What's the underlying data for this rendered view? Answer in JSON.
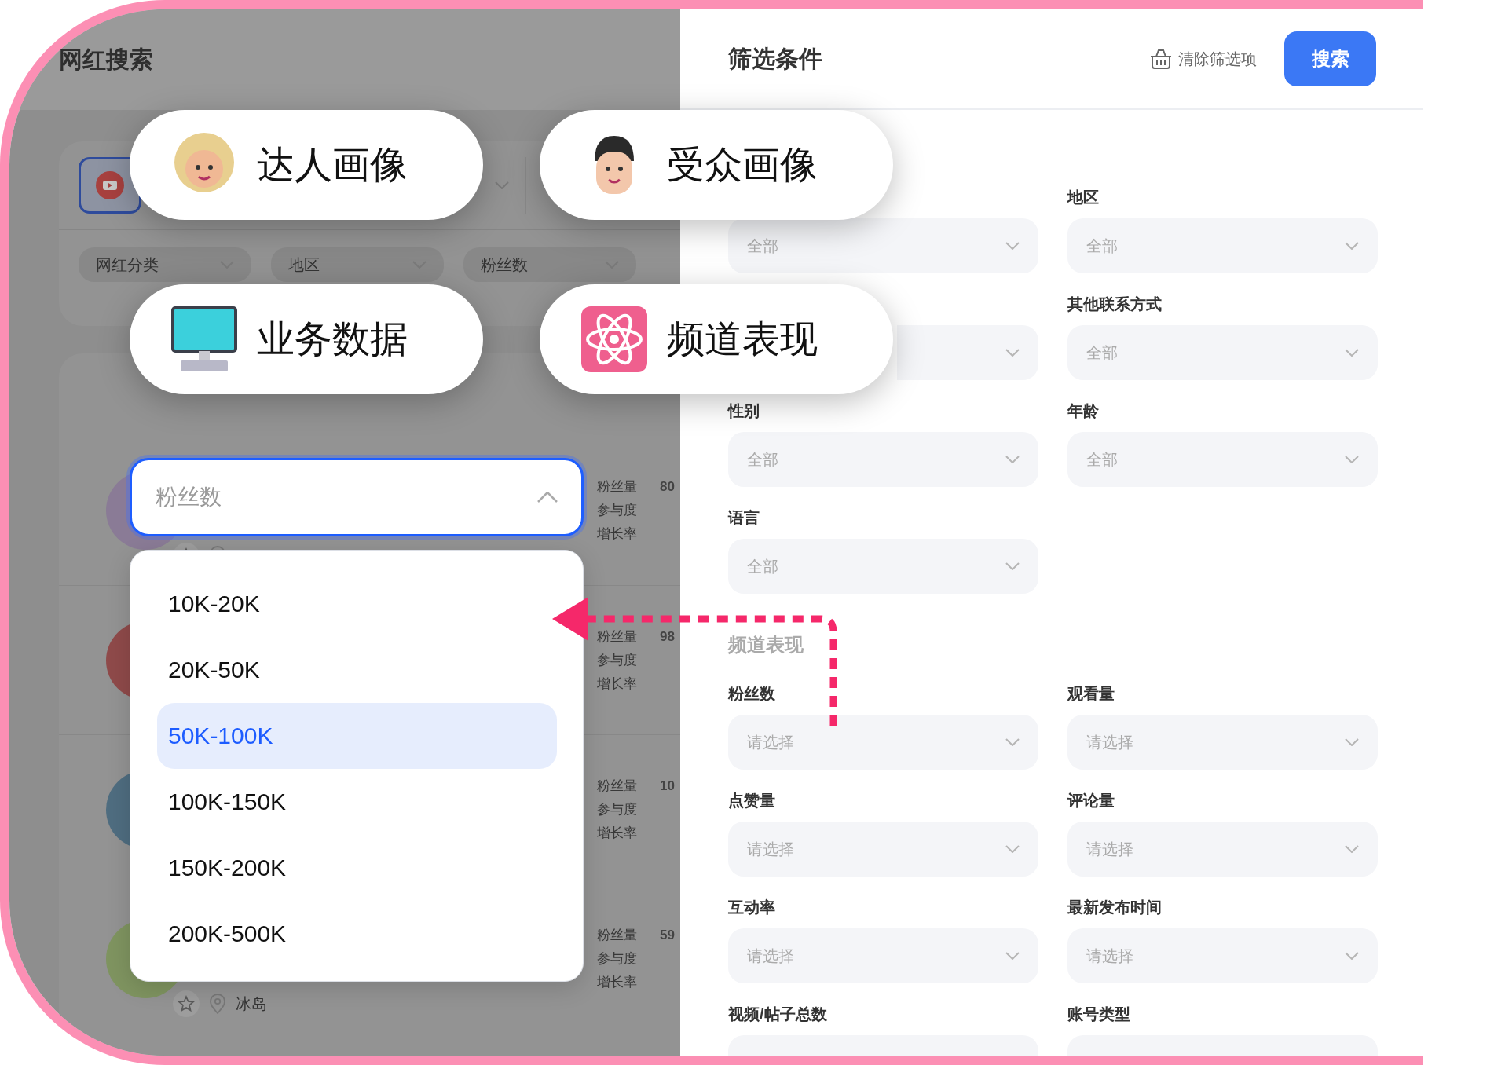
{
  "search_page": {
    "title": "网红搜索",
    "filter_chips": [
      {
        "label": "网红分类"
      },
      {
        "label": "地区"
      },
      {
        "label": "粉丝数"
      }
    ],
    "results": [
      {
        "stats": [
          {
            "label": "粉丝量",
            "value": "80"
          },
          {
            "label": "参与度"
          },
          {
            "label": "增长率"
          }
        ]
      },
      {
        "stats": [
          {
            "label": "粉丝量",
            "value": "98"
          },
          {
            "label": "参与度"
          },
          {
            "label": "增长率"
          }
        ]
      },
      {
        "stats": [
          {
            "label": "粉丝量",
            "value": "10"
          },
          {
            "label": "参与度"
          },
          {
            "label": "增长率"
          }
        ]
      },
      {
        "stats": [
          {
            "label": "粉丝量",
            "value": "59"
          },
          {
            "label": "参与度"
          },
          {
            "label": "增长率"
          }
        ],
        "location": "冰岛"
      }
    ]
  },
  "feature_pills": [
    {
      "label": "达人画像",
      "kind": "woman"
    },
    {
      "label": "受众画像",
      "kind": "man"
    },
    {
      "label": "业务数据",
      "kind": "monitor"
    },
    {
      "label": "频道表现",
      "kind": "atom"
    }
  ],
  "fans_dropdown": {
    "value": "粉丝数",
    "expanded": true,
    "options": [
      {
        "label": "10K-20K",
        "selected": false
      },
      {
        "label": "20K-50K",
        "selected": false
      },
      {
        "label": "50K-100K",
        "selected": true
      },
      {
        "label": "100K-150K",
        "selected": false
      },
      {
        "label": "150K-200K",
        "selected": false
      },
      {
        "label": "200K-500K",
        "selected": false
      }
    ]
  },
  "filter_panel": {
    "title": "筛选条件",
    "clear_label": "清除筛选项",
    "search_label": "搜索",
    "fields": [
      {
        "kind": "select",
        "value": "全部"
      },
      {
        "kind": "select",
        "label": "地区",
        "value": "全部"
      },
      {
        "kind": "select"
      },
      {
        "kind": "select",
        "label": "其他联系方式",
        "value": "全部"
      },
      {
        "kind": "select",
        "label": "性别",
        "value": "全部"
      },
      {
        "kind": "select",
        "label": "年龄",
        "value": "全部"
      },
      {
        "kind": "select",
        "label": "语言",
        "value": "全部"
      }
    ],
    "sections": [
      {
        "title": "频道表现",
        "fields": [
          {
            "kind": "select",
            "label": "粉丝数",
            "value": "请选择"
          },
          {
            "kind": "select",
            "label": "观看量",
            "value": "请选择"
          },
          {
            "kind": "select",
            "label": "点赞量",
            "value": "请选择"
          },
          {
            "kind": "select",
            "label": "评论量",
            "value": "请选择"
          },
          {
            "kind": "select",
            "label": "互动率",
            "value": "请选择"
          },
          {
            "kind": "select",
            "label": "最新发布时间",
            "value": "请选择"
          },
          {
            "kind": "select",
            "label": "视频/帖子总数"
          },
          {
            "kind": "select",
            "label": "账号类型"
          }
        ]
      }
    ]
  }
}
